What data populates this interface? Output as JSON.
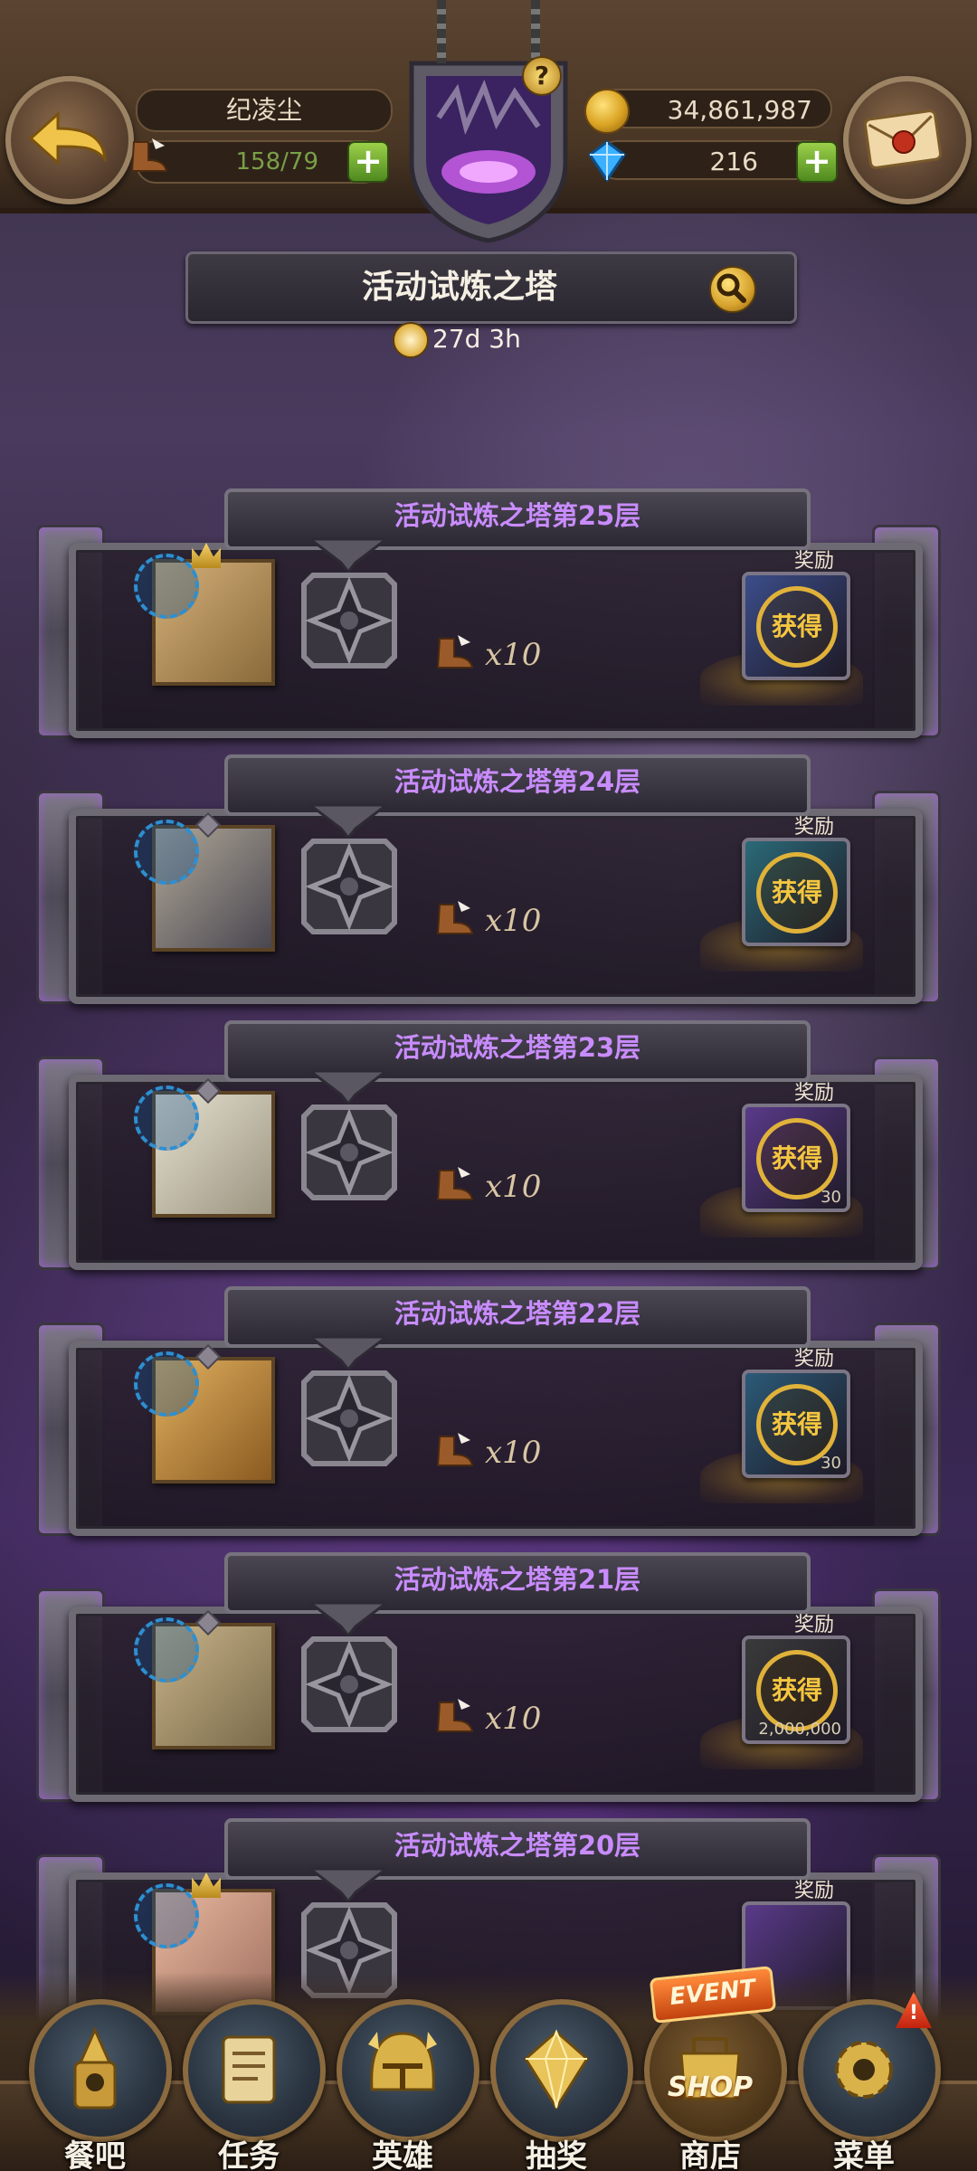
{
  "header": {
    "player_name": "纪凌尘",
    "stamina": "158/79",
    "gold": "34,861,987",
    "gems": "216",
    "plus_symbol": "+"
  },
  "event": {
    "title": "活动试炼之塔",
    "time_remaining": "27d 3h"
  },
  "floors": [
    {
      "title": "活动试炼之塔第25层",
      "cost": "x10",
      "reward_label": "奖励",
      "status": "获得",
      "reward_qty": "",
      "reward_color": "#3b4d8a"
    },
    {
      "title": "活动试炼之塔第24层",
      "cost": "x10",
      "reward_label": "奖励",
      "status": "获得",
      "reward_qty": "",
      "reward_color": "#2b6a78"
    },
    {
      "title": "活动试炼之塔第23层",
      "cost": "x10",
      "reward_label": "奖励",
      "status": "获得",
      "reward_qty": "30",
      "reward_color": "#5a3a8a"
    },
    {
      "title": "活动试炼之塔第22层",
      "cost": "x10",
      "reward_label": "奖励",
      "status": "获得",
      "reward_qty": "30",
      "reward_color": "#2b5a78"
    },
    {
      "title": "活动试炼之塔第21层",
      "cost": "x10",
      "reward_label": "奖励",
      "status": "获得",
      "reward_qty": "2,000,000",
      "reward_color": "#3a3a3a"
    },
    {
      "title": "活动试炼之塔第20层",
      "cost": "",
      "reward_label": "奖励",
      "status": "",
      "reward_qty": "",
      "reward_color": "#5a3a8a"
    }
  ],
  "bottom_nav": [
    {
      "label": "餐吧",
      "icon": "tavern-icon"
    },
    {
      "label": "任务",
      "icon": "quest-scroll-icon"
    },
    {
      "label": "英雄",
      "icon": "hero-helmet-icon"
    },
    {
      "label": "抽奖",
      "icon": "gem-draw-icon"
    },
    {
      "label": "商店",
      "icon": "event-shop-icon",
      "tag_top": "EVENT",
      "tag_mid": "SHOP"
    },
    {
      "label": "菜单",
      "icon": "gear-menu-icon",
      "alert": "!"
    }
  ],
  "colors": {
    "floor_title": "#c98cff",
    "obtained": "#f5c640",
    "plus_button": "#6aa52c"
  }
}
